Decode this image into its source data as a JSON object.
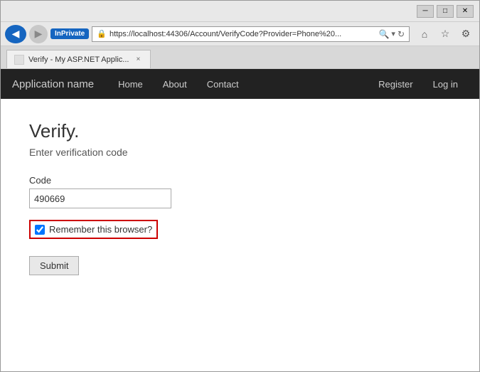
{
  "browser": {
    "title_bar": {
      "minimize_label": "─",
      "maximize_label": "□",
      "close_label": "✕"
    },
    "nav_bar": {
      "inprivate_label": "InPrivate",
      "address": "https://localhost:44306/Account/VerifyCode?Provider=Phone%20...",
      "back_icon": "◀",
      "forward_icon": "▶",
      "home_icon": "⌂",
      "star_icon": "☆",
      "settings_icon": "⚙",
      "lock_icon": "🔒",
      "refresh_icon": "↻",
      "search_icon": "🔍"
    },
    "tab_bar": {
      "tab_label": "Verify - My ASP.NET Applic...",
      "close_icon": "×"
    }
  },
  "app": {
    "brand": "Application name",
    "nav_links": [
      {
        "label": "Home"
      },
      {
        "label": "About"
      },
      {
        "label": "Contact"
      }
    ],
    "nav_right_links": [
      {
        "label": "Register"
      },
      {
        "label": "Log in"
      }
    ]
  },
  "page": {
    "title": "Verify.",
    "subtitle": "Enter verification code",
    "form": {
      "code_label": "Code",
      "code_value": "490669",
      "code_placeholder": "",
      "remember_label": "Remember this browser?",
      "submit_label": "Submit"
    }
  }
}
